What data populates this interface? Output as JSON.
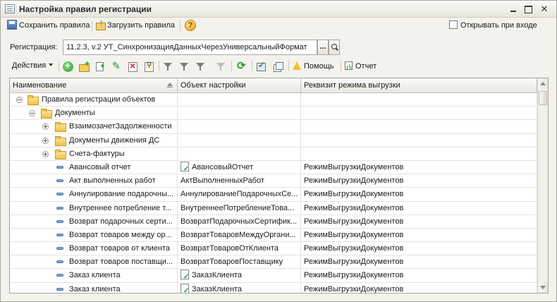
{
  "window": {
    "title": "Настройка правил регистрации",
    "min_label": "",
    "max_label": "",
    "close_label": "✕"
  },
  "toolbar": {
    "save_label": "Сохранить правила",
    "load_label": "Загрузить правила",
    "help_label": "?",
    "open_on_start_label": "Открывать при входе",
    "open_on_start_checked": false
  },
  "registration": {
    "label": "Регистрация:",
    "value": "11.2.3, v.2 УТ_СинхронизацияДанныхЧерезУниверсальныйФормат",
    "select_label": "..."
  },
  "actions_bar": {
    "actions_label": "Действия",
    "help_label": "Помощь",
    "report_label": "Отчет"
  },
  "table": {
    "columns": [
      "Наименование",
      "Объект настройки",
      "Реквизит режима выгрузки"
    ],
    "rows": [
      {
        "level": 0,
        "kind": "folder",
        "toggle": "minus",
        "name": "Правила регистрации объектов",
        "object": "",
        "object_icon": false,
        "attr": ""
      },
      {
        "level": 1,
        "kind": "folder",
        "toggle": "minus",
        "name": "Документы",
        "object": "",
        "object_icon": false,
        "attr": ""
      },
      {
        "level": 2,
        "kind": "folder",
        "toggle": "plus",
        "name": "ВзаимозачетЗадолженности",
        "object": "",
        "object_icon": false,
        "attr": ""
      },
      {
        "level": 2,
        "kind": "folder",
        "toggle": "plus",
        "name": "Документы движения ДС",
        "object": "",
        "object_icon": false,
        "attr": ""
      },
      {
        "level": 2,
        "kind": "folder",
        "toggle": "plus",
        "name": "Счета-фактуры",
        "object": "",
        "object_icon": false,
        "attr": ""
      },
      {
        "level": 2,
        "kind": "item",
        "toggle": "",
        "name": "Авансовый отчет",
        "object": "АвансовыйОтчет",
        "object_icon": true,
        "attr": "РежимВыгрузкиДокументов"
      },
      {
        "level": 2,
        "kind": "item",
        "toggle": "",
        "name": "Акт выполненных работ",
        "object": "АктВыполненныхРабот",
        "object_icon": false,
        "attr": "РежимВыгрузкиДокументов"
      },
      {
        "level": 2,
        "kind": "item",
        "toggle": "",
        "name": "Аннулирование подарочны...",
        "object": "АннулированиеПодарочныхСе...",
        "object_icon": false,
        "attr": "РежимВыгрузкиДокументов"
      },
      {
        "level": 2,
        "kind": "item",
        "toggle": "",
        "name": "Внутреннее потребление т...",
        "object": "ВнутреннееПотреблениеТова...",
        "object_icon": false,
        "attr": "РежимВыгрузкиДокументов"
      },
      {
        "level": 2,
        "kind": "item",
        "toggle": "",
        "name": "Возврат подарочных серти...",
        "object": "ВозвратПодарочныхСертифик...",
        "object_icon": false,
        "attr": "РежимВыгрузкиДокументов"
      },
      {
        "level": 2,
        "kind": "item",
        "toggle": "",
        "name": "Возврат товаров между ор...",
        "object": "ВозвратТоваровМеждуОргани...",
        "object_icon": false,
        "attr": "РежимВыгрузкиДокументов"
      },
      {
        "level": 2,
        "kind": "item",
        "toggle": "",
        "name": "Возврат товаров от клиента",
        "object": "ВозвратТоваровОтКлиента",
        "object_icon": false,
        "attr": "РежимВыгрузкиДокументов"
      },
      {
        "level": 2,
        "kind": "item",
        "toggle": "",
        "name": "Возврат товаров поставщи...",
        "object": "ВозвратТоваровПоставщику",
        "object_icon": false,
        "attr": "РежимВыгрузкиДокументов"
      },
      {
        "level": 2,
        "kind": "item",
        "toggle": "",
        "name": "Заказ клиента",
        "object": "ЗаказКлиента",
        "object_icon": true,
        "attr": "РежимВыгрузкиДокументов"
      },
      {
        "level": 2,
        "kind": "item",
        "toggle": "",
        "name": "Заказ клиента",
        "object": "ЗаказКлиента",
        "object_icon": true,
        "attr": "РежимВыгрузкиДокументов"
      }
    ]
  },
  "icons": {
    "window": "form-icon",
    "save": "floppy-disk-icon",
    "load": "folder-open-icon",
    "help": "question-icon",
    "add": "add-circle-icon",
    "add_group": "add-folder-icon",
    "copy": "copy-icon",
    "edit": "pencil-icon",
    "delete": "delete-icon",
    "mark": "mark-icon",
    "filter": "filter-icon",
    "refresh": "refresh-icon",
    "check": "check-icon",
    "pages": "pages-icon",
    "warning": "warning-icon",
    "report": "report-icon"
  }
}
